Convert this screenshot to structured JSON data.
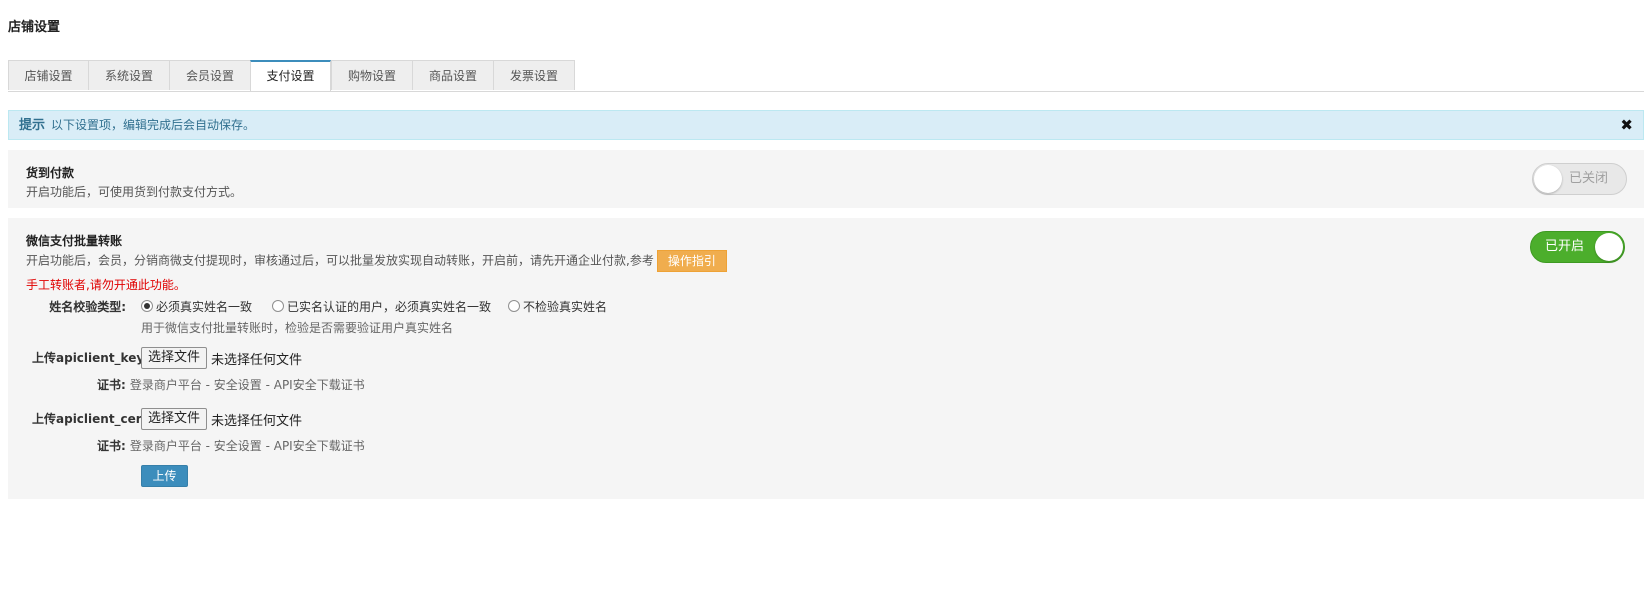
{
  "page": {
    "title": "店铺设置"
  },
  "tabs": [
    {
      "label": "店铺设置",
      "active": false
    },
    {
      "label": "系统设置",
      "active": false
    },
    {
      "label": "会员设置",
      "active": false
    },
    {
      "label": "支付设置",
      "active": true
    },
    {
      "label": "购物设置",
      "active": false
    },
    {
      "label": "商品设置",
      "active": false
    },
    {
      "label": "发票设置",
      "active": false
    }
  ],
  "alert": {
    "label": "提示",
    "message": "以下设置项，编辑完成后会自动保存。",
    "close_icon": "close-icon"
  },
  "cod": {
    "title": "货到付款",
    "description": "开启功能后，可使用货到付款支付方式。",
    "toggle_label": "已关闭",
    "enabled": false
  },
  "wechat": {
    "title": "微信支付批量转账",
    "description": "开启功能后，会员，分销商微支付提现时，审核通过后，可以批量发放实现自动转账，开启前，请先开通企业付款,参考",
    "guide_button": "操作指引",
    "warning": "手工转账者,请勿开通此功能。",
    "toggle_label": "已开启",
    "enabled": true,
    "name_check": {
      "label": "姓名校验类型:",
      "options": [
        {
          "label": "必须真实姓名一致",
          "checked": true
        },
        {
          "label": "已实名认证的用户，必须真实姓名一致",
          "checked": false
        },
        {
          "label": "不检验真实姓名",
          "checked": false
        }
      ],
      "help": "用于微信支付批量转账时，检验是否需要验证用户真实姓名"
    },
    "key_upload": {
      "label": "上传apiclient_key",
      "button": "选择文件",
      "status": "未选择任何文件",
      "cert_label": "证书:",
      "cert_hint": "登录商户平台 - 安全设置 - API安全下载证书"
    },
    "cert_upload": {
      "label": "上传apiclient_cert",
      "button": "选择文件",
      "status": "未选择任何文件",
      "cert_label": "证书:",
      "cert_hint": "登录商户平台 - 安全设置 - API安全下载证书"
    },
    "upload_button": "上传"
  },
  "colors": {
    "accent": "#3c8dbc",
    "toggle_on": "#4cae2c",
    "warning": "#e00000",
    "guide_button": "#f0ad4e",
    "alert_bg": "#d9edf7"
  }
}
